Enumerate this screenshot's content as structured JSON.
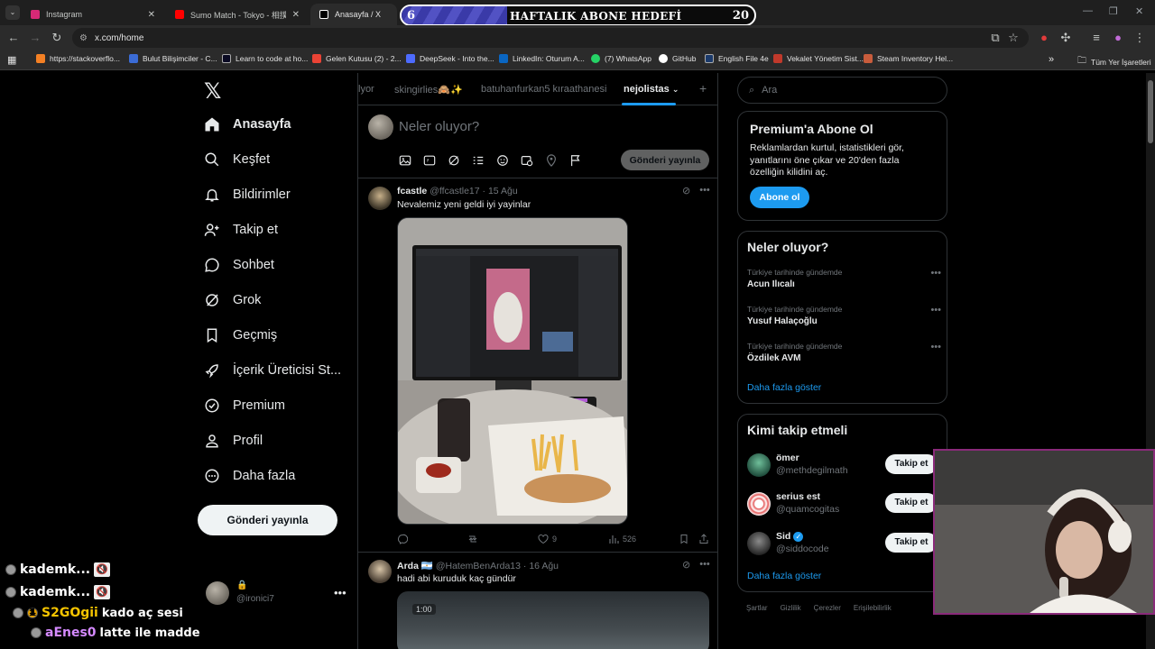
{
  "browser": {
    "tabs": [
      {
        "title": "Instagram",
        "color": "#d62976"
      },
      {
        "title": "Sumo Match - Tokyo - 相撲 - W",
        "color": "#ff0000"
      },
      {
        "title": "Anasayfa / X",
        "color": "#ffffff"
      }
    ],
    "url": "x.com/home",
    "bookmarks": [
      "https://stackoverflo...",
      "Bulut Bilişimciler - C...",
      "Learn to code at ho...",
      "Gelen Kutusu (2) - 2...",
      "DeepSeek - Into the...",
      "LinkedIn: Oturum A...",
      "(7) WhatsApp",
      "GitHub",
      "English File 4e",
      "Vekalet Yönetim Sist...",
      "Steam Inventory Hel..."
    ],
    "all_bookmarks": "Tüm Yer İşaretleri"
  },
  "goal": {
    "start": "6",
    "title": "HAFTALIK ABONE HEDEFİ",
    "end": "20",
    "progress": 0.3
  },
  "nav": {
    "items": [
      "Anasayfa",
      "Keşfet",
      "Bildirimler",
      "Takip et",
      "Sohbet",
      "Grok",
      "Geçmiş",
      "İçerik Üreticisi St...",
      "Premium",
      "Profil",
      "Daha fazla"
    ],
    "post_button": "Gönderi yayınla",
    "handle": "@ironici7"
  },
  "timeline": {
    "tabs": [
      "lyor",
      "skingirlies🙈✨",
      "batuhanfurkan5 kıraathanesi",
      "nejolistas"
    ],
    "compose_placeholder": "Neler oluyor?",
    "compose_post": "Gönderi yayınla",
    "tweets": [
      {
        "name": "fcastle",
        "handle": "@ffcastle17",
        "date": "· 15 Ağu",
        "text": "Nevalemiz yeni geldi iyi yayinlar",
        "likes": "9",
        "views": "526"
      },
      {
        "name": "Arda 🇦🇷",
        "handle": "@HatemBenArda13",
        "date": "· 16 Ağu",
        "text": "hadi abi kuruduk kaç gündür",
        "video_time": "1:00"
      }
    ]
  },
  "right": {
    "search_placeholder": "Ara",
    "premium": {
      "title": "Premium'a Abone Ol",
      "desc": "Reklamlardan kurtul, istatistikleri gör, yanıtlarını öne çıkar ve 20'den fazla özelliğin kilidini aç.",
      "button": "Abone ol"
    },
    "trends": {
      "title": "Neler oluyor?",
      "items": [
        {
          "category": "Türkiye tarihinde gündemde",
          "name": "Acun Ilıcalı"
        },
        {
          "category": "Türkiye tarihinde gündemde",
          "name": "Yusuf Halaçoğlu"
        },
        {
          "category": "Türkiye tarihinde gündemde",
          "name": "Özdilek AVM"
        }
      ],
      "more": "Daha fazla göster"
    },
    "who": {
      "title": "Kimi takip etmeli",
      "items": [
        {
          "name": "ömer",
          "handle": "@methdegilmath",
          "button": "Takip et"
        },
        {
          "name": "serius est",
          "handle": "@quamcogitas",
          "button": "Takip et"
        },
        {
          "name": "Sid",
          "handle": "@siddocode",
          "button": "Takip et"
        }
      ],
      "more": "Daha fazla göster"
    },
    "footer": [
      "Şartlar",
      "Gizlilik",
      "Çerezler",
      "Erişilebilirlik"
    ]
  },
  "chat": [
    {
      "user": "kademk..."
    },
    {
      "user": "kademk..."
    },
    {
      "user": "S2GOgii",
      "message": "kado aç sesi"
    },
    {
      "user": "aEnes0",
      "message": "latte ile madde"
    }
  ]
}
